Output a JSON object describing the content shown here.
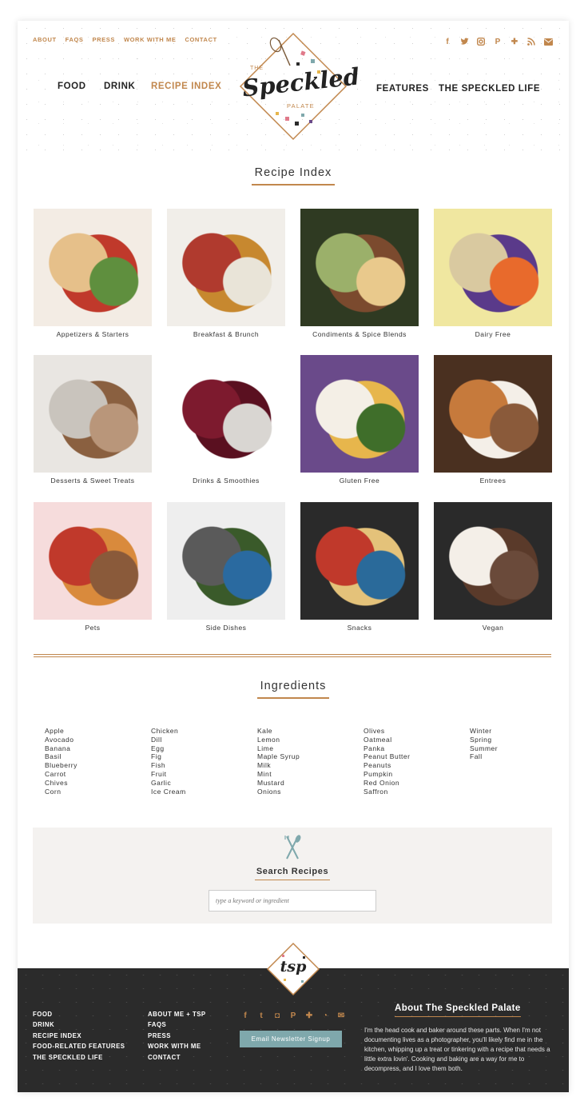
{
  "topnav": [
    "ABOUT",
    "FAQS",
    "PRESS",
    "WORK WITH ME",
    "CONTACT"
  ],
  "social_icons": [
    "facebook-icon",
    "twitter-icon",
    "instagram-icon",
    "pinterest-icon",
    "plus-icon",
    "rss-icon",
    "email-icon"
  ],
  "mainnav": {
    "food": "FOOD",
    "drink": "DRINK",
    "recipe_index": "RECIPE INDEX",
    "features": "FEATURES",
    "speckled_life": "THE SPECKLED LIFE"
  },
  "logo": {
    "the": "THE",
    "name": "Speckled",
    "sub": "PALATE"
  },
  "recipe_index_title": "Recipe Index",
  "categories": [
    {
      "label": "Appetizers & Starters",
      "colors": [
        "#f3ece4",
        "#c0392b",
        "#e6c08a",
        "#5f8f3e"
      ]
    },
    {
      "label": "Breakfast & Brunch",
      "colors": [
        "#f1eee9",
        "#c7882f",
        "#b03a2e",
        "#e9e4d8"
      ]
    },
    {
      "label": "Condiments & Spice Blends",
      "colors": [
        "#2f3a22",
        "#7b4a2e",
        "#9bb06a",
        "#e9c98c"
      ]
    },
    {
      "label": "Dairy Free",
      "colors": [
        "#f0e7a0",
        "#5a3a8a",
        "#d9c9a0",
        "#e86a2c"
      ]
    },
    {
      "label": "Desserts & Sweet Treats",
      "colors": [
        "#e9e6e2",
        "#8a6040",
        "#c9c4bd",
        "#b9967a"
      ]
    },
    {
      "label": "Drinks & Smoothies",
      "colors": [
        "#ffffff",
        "#5a1020",
        "#7d1a2e",
        "#d9d6d2"
      ]
    },
    {
      "label": "Gluten Free",
      "colors": [
        "#6a4a8a",
        "#e7b64c",
        "#f4efe6",
        "#3f6e2a"
      ]
    },
    {
      "label": "Entrees",
      "colors": [
        "#4a3020",
        "#f4efe8",
        "#c67a3c",
        "#8a5a3a"
      ]
    },
    {
      "label": "Pets",
      "colors": [
        "#f6dcdc",
        "#d98a3c",
        "#c0392b",
        "#8a5a3a"
      ]
    },
    {
      "label": "Side Dishes",
      "colors": [
        "#eeeeee",
        "#3a5a2a",
        "#5a5a5a",
        "#2a6aa0"
      ]
    },
    {
      "label": "Snacks",
      "colors": [
        "#2a2a2a",
        "#e4c27a",
        "#c0392b",
        "#2a6a9a"
      ]
    },
    {
      "label": "Vegan",
      "colors": [
        "#2a2a2a",
        "#5a3a2a",
        "#f4efe8",
        "#6a4a3a"
      ]
    }
  ],
  "ingredients_title": "Ingredients",
  "ingredients": [
    [
      "Apple",
      "Avocado",
      "Banana",
      "Basil",
      "Blueberry",
      "Carrot",
      "Chives",
      "Corn"
    ],
    [
      "Chicken",
      "Dill",
      "Egg",
      "Fig",
      "Fish",
      "Fruit",
      "Garlic",
      "Ice Cream"
    ],
    [
      "Kale",
      "Lemon",
      "Lime",
      "Maple Syrup",
      "Milk",
      "Mint",
      "Mustard",
      "Onions"
    ],
    [
      "Olives",
      "Oatmeal",
      "Panka",
      "Peanut Butter",
      "Peanuts",
      "Pumpkin",
      "Red Onion",
      "Saffron"
    ],
    [
      "Winter",
      "Spring",
      "Summer",
      "Fall"
    ]
  ],
  "search": {
    "title": "Search Recipes",
    "placeholder": "type a keyword or ingredient"
  },
  "footer": {
    "logo_text": "tsp",
    "col1": [
      "FOOD",
      "DRINK",
      "RECIPE INDEX",
      "FOOD-RELATED FEATURES",
      "THE SPECKLED LIFE"
    ],
    "col2": [
      "ABOUT ME + TSP",
      "FAQS",
      "PRESS",
      "WORK WITH ME",
      "CONTACT"
    ],
    "newsletter": "Email Newsletter Signup",
    "about_title": "About The Speckled Palate",
    "about_text": "I'm the head cook and baker around these parts. When I'm not documenting lives as a photographer, you'll likely find me in the kitchen, whipping up a treat or tinkering with a recipe that needs a little extra lovin'. Cooking and baking are a way for me to decompress, and I love them both."
  },
  "colors": {
    "accent": "#c1874d",
    "teal": "#7fa8ac",
    "footer_bg": "#2b2b2b"
  }
}
